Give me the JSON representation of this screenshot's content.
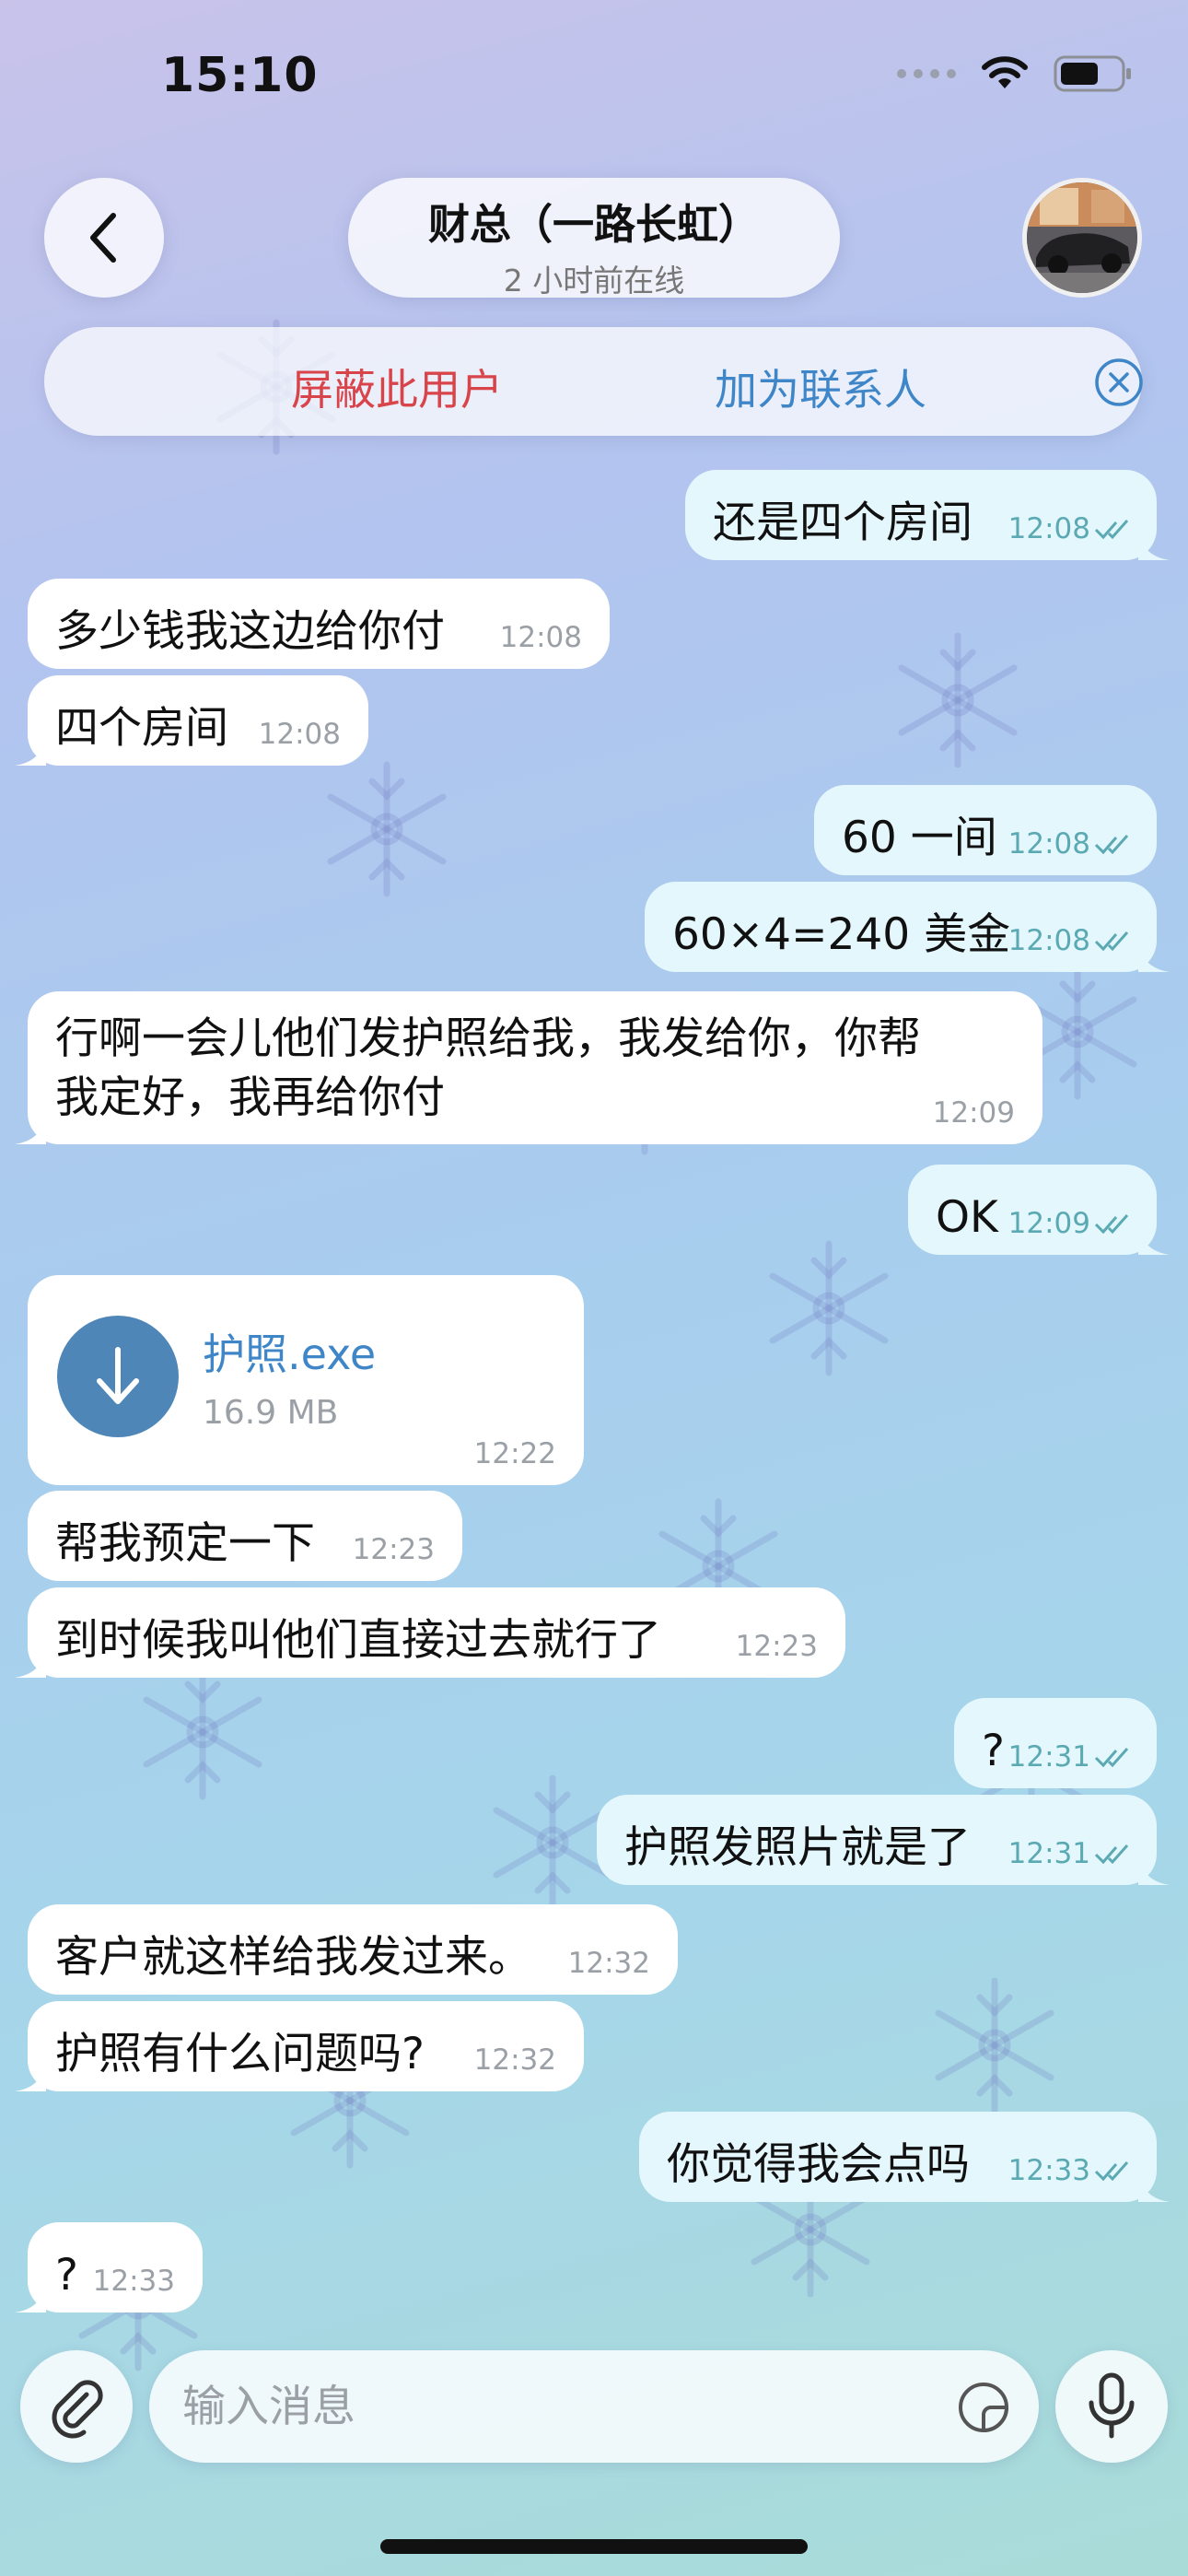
{
  "status_bar": {
    "time": "15:10"
  },
  "header": {
    "back_icon": "chevron-left-icon",
    "contact_name": "财总（一路长虹）",
    "last_seen": "2 小时前在线"
  },
  "action_bar": {
    "block_label": "屏蔽此用户",
    "add_contact_label": "加为联系人",
    "close_icon": "close-circle-icon",
    "block_color": "#d9434a",
    "accent_color": "#3f86c8"
  },
  "messages": [
    {
      "direction": "out",
      "text": "还是四个房间",
      "time": "12:08",
      "read": true
    },
    {
      "direction": "in",
      "text": "多少钱我这边给你付",
      "time": "12:08"
    },
    {
      "direction": "in",
      "text": "四个房间",
      "time": "12:08"
    },
    {
      "direction": "out",
      "text": "60 一间",
      "time": "12:08",
      "read": true
    },
    {
      "direction": "out",
      "text": "60×4=240 美金",
      "time": "12:08",
      "read": true
    },
    {
      "direction": "in",
      "text_line1": "行啊一会儿他们发护照给我，我发给你，你帮",
      "text_line2": "我定好，我再给你付",
      "time": "12:09"
    },
    {
      "direction": "out",
      "text": "OK",
      "time": "12:09",
      "read": true
    },
    {
      "direction": "in",
      "type": "file",
      "file_name": "护照.exe",
      "file_size": "16.9 MB",
      "time": "12:22",
      "icon": "download-arrow-icon"
    },
    {
      "direction": "in",
      "text": "帮我预定一下",
      "time": "12:23"
    },
    {
      "direction": "in",
      "text": "到时候我叫他们直接过去就行了",
      "time": "12:23"
    },
    {
      "direction": "out",
      "text": "?",
      "time": "12:31",
      "read": true
    },
    {
      "direction": "out",
      "text": "护照发照片就是了",
      "time": "12:31",
      "read": true
    },
    {
      "direction": "in",
      "text": "客户就这样给我发过来。",
      "time": "12:32"
    },
    {
      "direction": "in",
      "text": "护照有什么问题吗?",
      "time": "12:32"
    },
    {
      "direction": "out",
      "text": "你觉得我会点吗",
      "time": "12:33",
      "read": true
    },
    {
      "direction": "in",
      "text": "?",
      "time": "12:33"
    }
  ],
  "composer": {
    "placeholder": "输入消息",
    "attach_icon": "paperclip-icon",
    "sticker_icon": "sticker-icon",
    "mic_icon": "microphone-icon"
  },
  "colors": {
    "incoming_bubble": "#ffffff",
    "outgoing_bubble": "#e4f7fc",
    "read_ticks": "#5aa9b3"
  }
}
